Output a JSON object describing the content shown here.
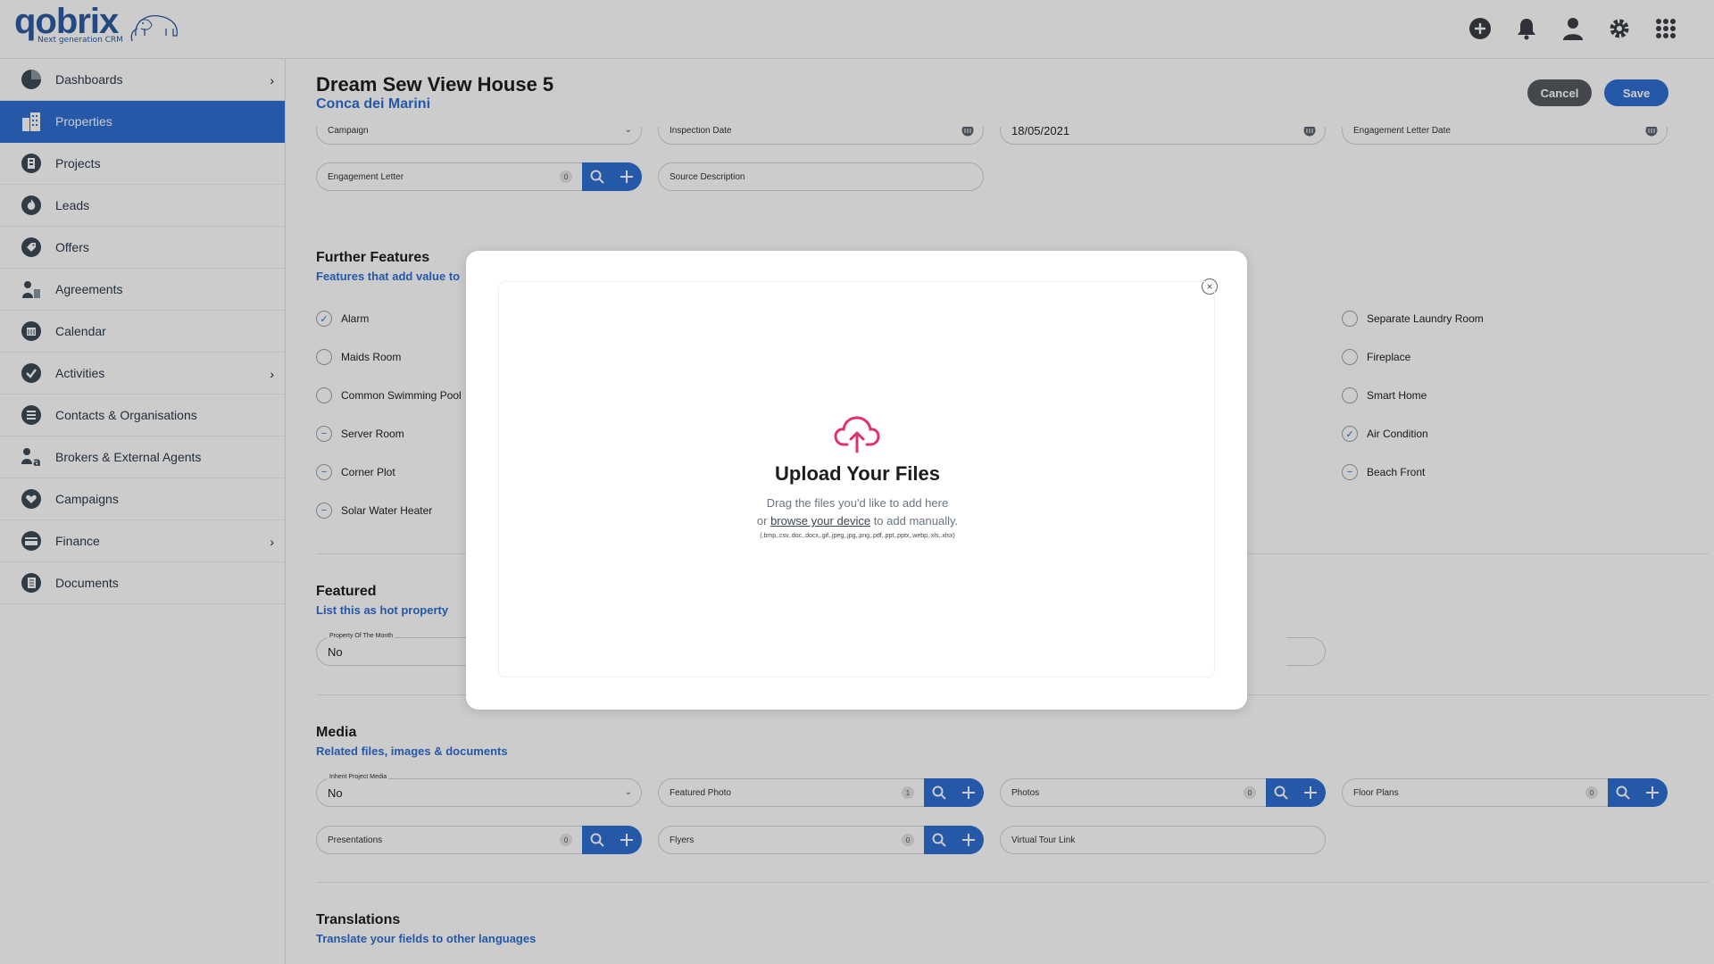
{
  "brand": {
    "name": "qobrix",
    "tagline": "Next generation CRM"
  },
  "topbar": {
    "icons": [
      "plus-circle-icon",
      "bell-icon",
      "user-icon",
      "gear-icon",
      "apps-grid-icon"
    ]
  },
  "sidebar": {
    "items": [
      {
        "label": "Dashboards",
        "icon": "pie-chart-icon",
        "has_children": true
      },
      {
        "label": "Properties",
        "icon": "building-icon",
        "active": true
      },
      {
        "label": "Projects",
        "icon": "projects-icon"
      },
      {
        "label": "Leads",
        "icon": "fire-icon"
      },
      {
        "label": "Offers",
        "icon": "tag-icon"
      },
      {
        "label": "Agreements",
        "icon": "agreements-icon"
      },
      {
        "label": "Calendar",
        "icon": "calendar-icon"
      },
      {
        "label": "Activities",
        "icon": "check-icon",
        "has_children": true
      },
      {
        "label": "Contacts & Organisations",
        "icon": "contacts-icon"
      },
      {
        "label": "Brokers & External Agents",
        "icon": "brokers-icon"
      },
      {
        "label": "Campaigns",
        "icon": "heart-icon"
      },
      {
        "label": "Finance",
        "icon": "finance-icon",
        "has_children": true
      },
      {
        "label": "Documents",
        "icon": "documents-icon"
      }
    ]
  },
  "header": {
    "title": "Dream Sew View House 5",
    "subtitle": "Conca dei Marini",
    "cancel_label": "Cancel",
    "save_label": "Save"
  },
  "top_fields": {
    "campaign": "Campaign",
    "inspection_date": "Inspection Date",
    "date_value": "18/05/2021",
    "engagement_letter_date": "Engagement Letter Date",
    "engagement_letter": "Engagement Letter",
    "engagement_letter_count": "0",
    "source_description": "Source Description"
  },
  "further_features": {
    "title": "Further Features",
    "subtitle": "Features that add value to",
    "left": [
      {
        "label": "Alarm",
        "state": "checked"
      },
      {
        "label": "Maids Room",
        "state": "empty"
      },
      {
        "label": "Common Swimming Pool",
        "state": "empty"
      },
      {
        "label": "Server Room",
        "state": "minus"
      },
      {
        "label": "Corner Plot",
        "state": "minus"
      },
      {
        "label": "Solar Water Heater",
        "state": "minus"
      }
    ],
    "right": [
      {
        "label": "Separate Laundry Room",
        "state": "empty"
      },
      {
        "label": "Fireplace",
        "state": "empty"
      },
      {
        "label": "Smart Home",
        "state": "empty"
      },
      {
        "label": "Air Condition",
        "state": "checked"
      },
      {
        "label": "Beach Front",
        "state": "minus"
      }
    ]
  },
  "featured": {
    "title": "Featured",
    "subtitle": "List this as hot property",
    "property_of_month_label": "Property Of The Month",
    "property_of_month_value": "No"
  },
  "media": {
    "title": "Media",
    "subtitle": "Related files, images & documents",
    "inherit_label": "Inherit Project Media",
    "inherit_value": "No",
    "featured_photo": "Featured Photo",
    "featured_photo_count": "1",
    "photos": "Photos",
    "photos_count": "0",
    "floor_plans": "Floor Plans",
    "floor_plans_count": "0",
    "presentations": "Presentations",
    "presentations_count": "0",
    "flyers": "Flyers",
    "flyers_count": "0",
    "virtual_tour": "Virtual Tour Link"
  },
  "translations": {
    "title": "Translations",
    "subtitle": "Translate your fields to other languages"
  },
  "modal": {
    "title": "Upload Your Files",
    "line1": "Drag the files you'd like to add here",
    "line2_prefix": "or",
    "line2_link": "browse your device",
    "line2_suffix": "to add manually.",
    "file_types": "(.bmp,.csv,.doc,.docx,.gif,.jpeg,.jpg,.png,.pdf,.ppt,.pptx,.webp,.xls,.xlsx)",
    "accent_color": "#e0336e"
  },
  "colors": {
    "primary": "#2f6fd1",
    "dark_button": "#555a60"
  }
}
